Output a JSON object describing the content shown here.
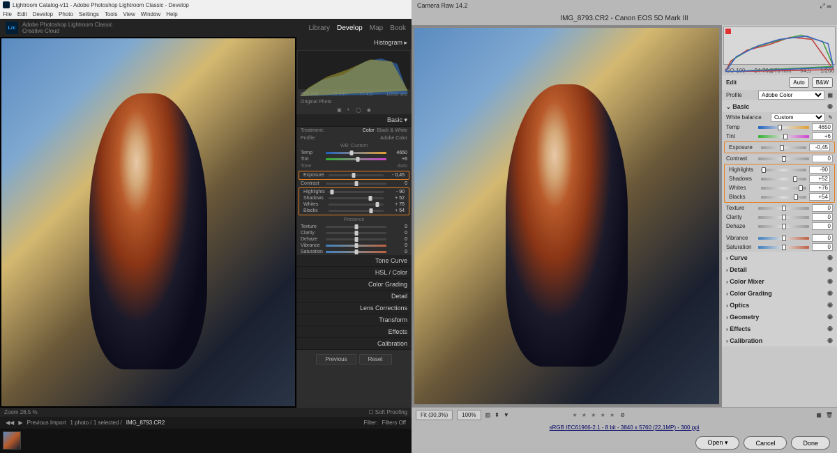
{
  "lr": {
    "title": "Lightroom Catalog-v11 - Adobe Photoshop Lightroom Classic - Develop",
    "menu": [
      "File",
      "Edit",
      "Develop",
      "Photo",
      "Settings",
      "Tools",
      "View",
      "Window",
      "Help"
    ],
    "brand_logo": "Lrc",
    "brand_line1": "Adobe Photoshop Lightroom Classic",
    "brand_line2": "Creative Cloud",
    "modules": {
      "library": "Library",
      "develop": "Develop",
      "map": "Map",
      "book": "Book"
    },
    "histogram_label": "Histogram",
    "histo_meta": {
      "iso": "ISO 100",
      "focal": "70 mm",
      "aperture": "f / 4.5",
      "shutter": "1/200 sec"
    },
    "original": "Original Photo",
    "basic": "Basic",
    "treatment": "Treatment:",
    "color": "Color",
    "bw": "Black & White",
    "profile_lbl": "Profile:",
    "profile_val": "Adobe Color",
    "wb_lbl": "WB:",
    "wb_val": "Custom",
    "tone_lbl": "Tone",
    "auto": "Auto",
    "presence_lbl": "Presence",
    "sliders": {
      "temp": {
        "l": "Temp",
        "v": "4650",
        "p": 42
      },
      "tint": {
        "l": "Tint",
        "v": "+6",
        "p": 53
      },
      "exposure": {
        "l": "Exposure",
        "v": "- 0,45",
        "p": 46
      },
      "contrast": {
        "l": "Contrast",
        "v": "0",
        "p": 50
      },
      "highlights": {
        "l": "Highlights",
        "v": "- 90",
        "p": 6
      },
      "shadows": {
        "l": "Shadows",
        "v": "+ 52",
        "p": 76
      },
      "whites": {
        "l": "Whites",
        "v": "+ 76",
        "p": 88
      },
      "blacks": {
        "l": "Blacks",
        "v": "+ 54",
        "p": 77
      },
      "texture": {
        "l": "Texture",
        "v": "0",
        "p": 50
      },
      "clarity": {
        "l": "Clarity",
        "v": "0",
        "p": 50
      },
      "dehaze": {
        "l": "Dehaze",
        "v": "0",
        "p": 50
      },
      "vibrance": {
        "l": "Vibrance",
        "v": "0",
        "p": 50
      },
      "saturation": {
        "l": "Saturation",
        "v": "0",
        "p": 50
      }
    },
    "panels": [
      "Tone Curve",
      "HSL / Color",
      "Color Grading",
      "Detail",
      "Lens Corrections",
      "Transform",
      "Effects",
      "Calibration"
    ],
    "previous": "Previous",
    "reset": "Reset",
    "zoom": "Zoom",
    "zoom_val": "28.5 %",
    "softproof": "Soft Proofing",
    "prev_import": "Previous Import",
    "count": "1 photo / 1 selected /",
    "filename": "IMG_8793.CR2",
    "filter": "Filter:",
    "filters_off": "Filters Off"
  },
  "cr": {
    "app": "Camera Raw 14.2",
    "header": "IMG_8793.CR2  -  Canon EOS 5D Mark III",
    "meta": {
      "iso": "ISO 100",
      "lens": "24-70@70 mm",
      "aperture": "f/4,5",
      "shutter": "1/200"
    },
    "edit": "Edit",
    "auto": "Auto",
    "bw": "B&W",
    "profile_lbl": "Profile",
    "profile_val": "Adobe Color",
    "basic": "Basic",
    "wb_lbl": "White balance",
    "wb_val": "Custom",
    "sliders": {
      "temp": {
        "l": "Temp",
        "v": "4650",
        "p": 42
      },
      "tint": {
        "l": "Tint",
        "v": "+6",
        "p": 53
      },
      "exposure": {
        "l": "Exposure",
        "v": "-0,45",
        "p": 46
      },
      "contrast": {
        "l": "Contrast",
        "v": "0",
        "p": 50
      },
      "highlights": {
        "l": "Highlights",
        "v": "-90",
        "p": 6
      },
      "shadows": {
        "l": "Shadows",
        "v": "+52",
        "p": 76
      },
      "whites": {
        "l": "Whites",
        "v": "+76",
        "p": 88
      },
      "blacks": {
        "l": "Blacks",
        "v": "+54",
        "p": 77
      },
      "texture": {
        "l": "Texture",
        "v": "0",
        "p": 50
      },
      "clarity": {
        "l": "Clarity",
        "v": "0",
        "p": 50
      },
      "dehaze": {
        "l": "Dehaze",
        "v": "0",
        "p": 50
      },
      "vibrance": {
        "l": "Vibrance",
        "v": "0",
        "p": 50
      },
      "saturation": {
        "l": "Saturation",
        "v": "0",
        "p": 50
      }
    },
    "panels": [
      "Curve",
      "Detail",
      "Color Mixer",
      "Color Grading",
      "Optics",
      "Geometry",
      "Effects",
      "Calibration"
    ],
    "fit": "Fit (30,3%)",
    "hundred": "100%",
    "footer": "sRGB IEC61966-2.1 - 8 bit - 3840 x 5760 (22,1MP) - 300 ppi",
    "open": "Open",
    "cancel": "Cancel",
    "done": "Done"
  }
}
